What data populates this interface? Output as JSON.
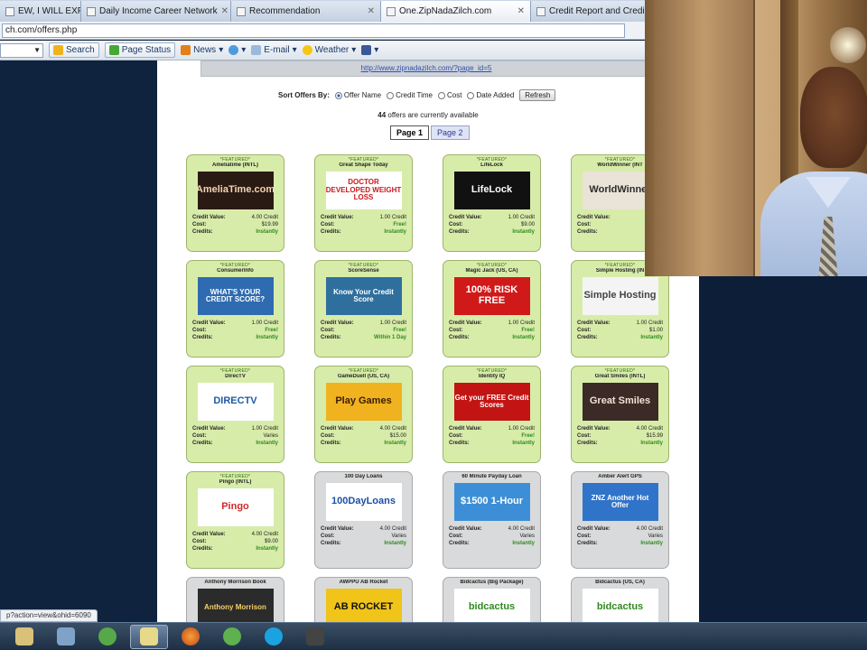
{
  "tabs": [
    {
      "label": "EW, I WILL EXP...",
      "active": false
    },
    {
      "label": "Daily Income Career Network",
      "active": false
    },
    {
      "label": "Recommendation",
      "active": false
    },
    {
      "label": "One.ZipNadaZilch.com",
      "active": true
    },
    {
      "label": "Credit Report and Credit F",
      "active": false
    }
  ],
  "address": {
    "url": "ch.com/offers.php"
  },
  "toolbar": {
    "search_label": "Search",
    "page_status_label": "Page Status",
    "news_label": "News",
    "email_label": "E-mail",
    "weather_label": "Weather"
  },
  "banner": {
    "link": "http://www.zipnadazilch.com/?page_id=5"
  },
  "sort": {
    "label": "Sort Offers By:",
    "options": [
      "Offer Name",
      "Credit Time",
      "Cost",
      "Date Added"
    ],
    "selected_index": 0,
    "refresh": "Refresh"
  },
  "count": {
    "number": "44",
    "text": "offers are currently available"
  },
  "pager": {
    "pages": [
      "Page 1",
      "Page 2"
    ],
    "current": 0
  },
  "labels": {
    "featured": "*FEATURED*",
    "credit_value": "Credit Value:",
    "cost": "Cost:",
    "credits": "Credits:"
  },
  "offers": [
    {
      "title": "Ameliatime (INTL)",
      "img": "AmeliaTime.com",
      "img_bg": "#2a1a14",
      "img_fg": "#f0d6b0",
      "value": "4.00 Credit",
      "cost": "$19.99",
      "credits": "Instantly",
      "featured": true,
      "gray": false
    },
    {
      "title": "Great Shape Today",
      "img": "DOCTOR DEVELOPED WEIGHT LOSS",
      "img_bg": "#ffffff",
      "img_fg": "#c8191d",
      "value": "1.00 Credit",
      "cost": "Free!",
      "credits": "Instantly",
      "featured": true,
      "gray": false
    },
    {
      "title": "LifeLock",
      "img": "LifeLock",
      "img_bg": "#111111",
      "img_fg": "#ffffff",
      "value": "1.00 Credit",
      "cost": "$9.00",
      "credits": "Instantly",
      "featured": true,
      "gray": false
    },
    {
      "title": "WorldWinner (INT",
      "img": "WorldWinner",
      "img_bg": "#e9e4d7",
      "img_fg": "#2b2b2b",
      "value": "4.00 Cr",
      "cost": "$1",
      "credits": "Instan",
      "featured": true,
      "gray": false
    },
    {
      "title": "ConsumerInfo",
      "img": "WHAT'S YOUR CREDIT SCORE?",
      "img_bg": "#2f6bb0",
      "img_fg": "#ffffff",
      "value": "1.00 Credit",
      "cost": "Free!",
      "credits": "Instantly",
      "featured": true,
      "gray": false
    },
    {
      "title": "ScoreSense",
      "img": "Know Your Credit Score",
      "img_bg": "#2e6f9e",
      "img_fg": "#ffffff",
      "value": "1.00 Credit",
      "cost": "Free!",
      "credits": "Within 1 Day",
      "featured": true,
      "gray": false
    },
    {
      "title": "Magic Jack (US, CA)",
      "img": "100% RISK FREE",
      "img_bg": "#d01a1a",
      "img_fg": "#ffffff",
      "value": "1.00 Credit",
      "cost": "Free!",
      "credits": "Instantly",
      "featured": true,
      "gray": false
    },
    {
      "title": "Simple Hosting (IN",
      "img": "Simple Hosting",
      "img_bg": "#f4f4f4",
      "img_fg": "#444444",
      "value": "1.00 Credit",
      "cost": "$1.00",
      "credits": "Instantly",
      "featured": true,
      "gray": false
    },
    {
      "title": "DirecTV",
      "img": "DIRECTV",
      "img_bg": "#ffffff",
      "img_fg": "#1f5aa6",
      "value": "1.00 Credit",
      "cost": "Varies",
      "credits": "Instantly",
      "featured": true,
      "gray": false
    },
    {
      "title": "GameDuell (US, CA)",
      "img": "Play Games",
      "img_bg": "#f0b21f",
      "img_fg": "#3a1d00",
      "value": "4.00 Credit",
      "cost": "$15.00",
      "credits": "Instantly",
      "featured": true,
      "gray": false
    },
    {
      "title": "Identity IQ",
      "img": "Get your FREE Credit Scores",
      "img_bg": "#c31414",
      "img_fg": "#ffffff",
      "value": "1.00 Credit",
      "cost": "Free!",
      "credits": "Instantly",
      "featured": true,
      "gray": false
    },
    {
      "title": "Great Smiles (INTL)",
      "img": "Great Smiles",
      "img_bg": "#3b2a26",
      "img_fg": "#f2e3d4",
      "value": "4.00 Credit",
      "cost": "$15.99",
      "credits": "Instantly",
      "featured": true,
      "gray": false
    },
    {
      "title": "Pingo (INTL)",
      "img": "Pingo",
      "img_bg": "#ffffff",
      "img_fg": "#d12b2b",
      "value": "4.00 Credit",
      "cost": "$9.00",
      "credits": "Instantly",
      "featured": true,
      "gray": false
    },
    {
      "title": "100 Day Loans",
      "img": "100DayLoans",
      "img_bg": "#ffffff",
      "img_fg": "#1d4fa3",
      "value": "4.00 Credit",
      "cost": "Varies",
      "credits": "Instantly",
      "featured": false,
      "gray": true
    },
    {
      "title": "60 Minute Payday Loan",
      "img": "$1500 1-Hour",
      "img_bg": "#3c8fd6",
      "img_fg": "#ffffff",
      "value": "4.00 Credit",
      "cost": "Varies",
      "credits": "Instantly",
      "featured": false,
      "gray": true
    },
    {
      "title": "Amber Alert GPS",
      "img": "ZNZ Another Hot Offer",
      "img_bg": "#2f74c9",
      "img_fg": "#ffffff",
      "value": "4.00 Credit",
      "cost": "Varies",
      "credits": "Instantly",
      "featured": false,
      "gray": true
    },
    {
      "title": "Anthony Morrison Book",
      "img": "Anthony Morrison",
      "img_bg": "#2b2b2b",
      "img_fg": "#f4d16a",
      "value": "",
      "cost": "",
      "credits": "",
      "featured": false,
      "gray": true
    },
    {
      "title": "AWPPU AB Rocket",
      "img": "AB ROCKET",
      "img_bg": "#f0c419",
      "img_fg": "#111111",
      "value": "",
      "cost": "",
      "credits": "",
      "featured": false,
      "gray": true
    },
    {
      "title": "Bidcactus (Big Package)",
      "img": "bidcactus",
      "img_bg": "#ffffff",
      "img_fg": "#2f8a1e",
      "value": "",
      "cost": "",
      "credits": "",
      "featured": false,
      "gray": true
    },
    {
      "title": "Bidcactus (US, CA)",
      "img": "bidcactus",
      "img_bg": "#ffffff",
      "img_fg": "#2f8a1e",
      "value": "",
      "cost": "",
      "credits": "",
      "featured": false,
      "gray": true
    }
  ],
  "status": {
    "text": "p?action=view&ohid=6090"
  },
  "colors": {
    "card_green": "#d8ecaa",
    "card_gray": "#d9dadb",
    "link": "#2b4fb5"
  }
}
